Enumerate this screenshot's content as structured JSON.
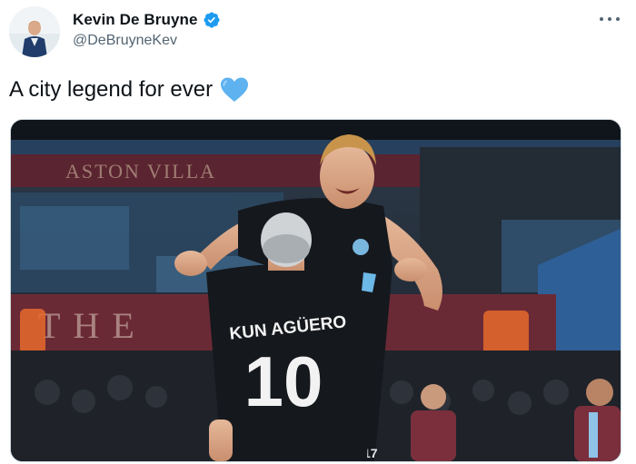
{
  "tweet": {
    "author": {
      "display_name": "Kevin De Bruyne",
      "handle": "@DeBruyneKev",
      "verified": true,
      "avatar_icon": "profile-photo"
    },
    "text": "A city legend for ever",
    "emoji": "blue-heart",
    "emoji_color": "#5eb2f0",
    "more_icon": "more-horizontal-icon",
    "media": {
      "type": "photo",
      "signage_upper": "ASTON VILLA",
      "signage_lower": "THE",
      "shirt_name": "KUN AGÜERO",
      "shirt_number": "10",
      "shirt_number_small": "17"
    }
  },
  "colors": {
    "verified_blue": "#1d9bf0",
    "text_primary": "#0f1419",
    "text_secondary": "#536471",
    "kit_dark": "#15181d",
    "kit_accent": "#6cb8e6"
  }
}
